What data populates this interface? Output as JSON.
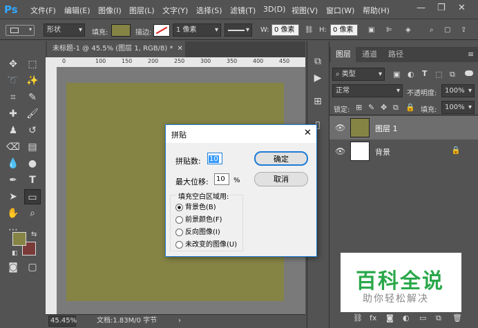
{
  "app": {
    "logo": "Ps",
    "menus": [
      "文件(F)",
      "编辑(E)",
      "图像(I)",
      "图层(L)",
      "文字(Y)",
      "选择(S)",
      "滤镜(T)",
      "3D(D)",
      "视图(V)",
      "窗口(W)",
      "帮助(H)"
    ]
  },
  "options": {
    "shape_mode": "形状",
    "fill_label": "填充:",
    "stroke_label": "描边:",
    "stroke_width": "1 像素",
    "w_label": "W:",
    "w_value": "0 像素",
    "h_label": "H:",
    "h_value": "0 像素"
  },
  "document": {
    "tab_title": "未标题-1 @ 45.5% (图层 1, RGB/8) *",
    "ruler_ticks": [
      "0",
      "100",
      "150",
      "200",
      "250",
      "300",
      "350",
      "400",
      "450"
    ],
    "zoom": "45.45%",
    "doc_info": "文档:1.83M/0 字节",
    "canvas_color": "#858445"
  },
  "layers_panel": {
    "tabs": [
      "图层",
      "通道",
      "路径"
    ],
    "filter_type": "类型",
    "blend_mode": "正常",
    "opacity_label": "不透明度:",
    "opacity": "100%",
    "lock_label": "锁定:",
    "fill_label": "填充:",
    "fill": "100%",
    "layers": [
      {
        "name": "图层 1",
        "color": "#858445"
      },
      {
        "name": "背景",
        "color": "#ffffff"
      }
    ]
  },
  "dialog": {
    "title": "拼贴",
    "tile_count_label": "拼贴数:",
    "tile_count": "10",
    "max_offset_label": "最大位移:",
    "max_offset": "10",
    "percent": "%",
    "ok": "确定",
    "cancel": "取消",
    "group_label": "填充空白区域用:",
    "options": [
      "背景色(B)",
      "前景颜色(F)",
      "反向图像(I)",
      "未改变的图像(U)"
    ]
  },
  "watermark": {
    "title": "百科全说",
    "subtitle": "助你轻松解决"
  },
  "colors": {
    "foreground": "#858445",
    "background": "#7a3a3a",
    "accent": "#31a8ff"
  }
}
